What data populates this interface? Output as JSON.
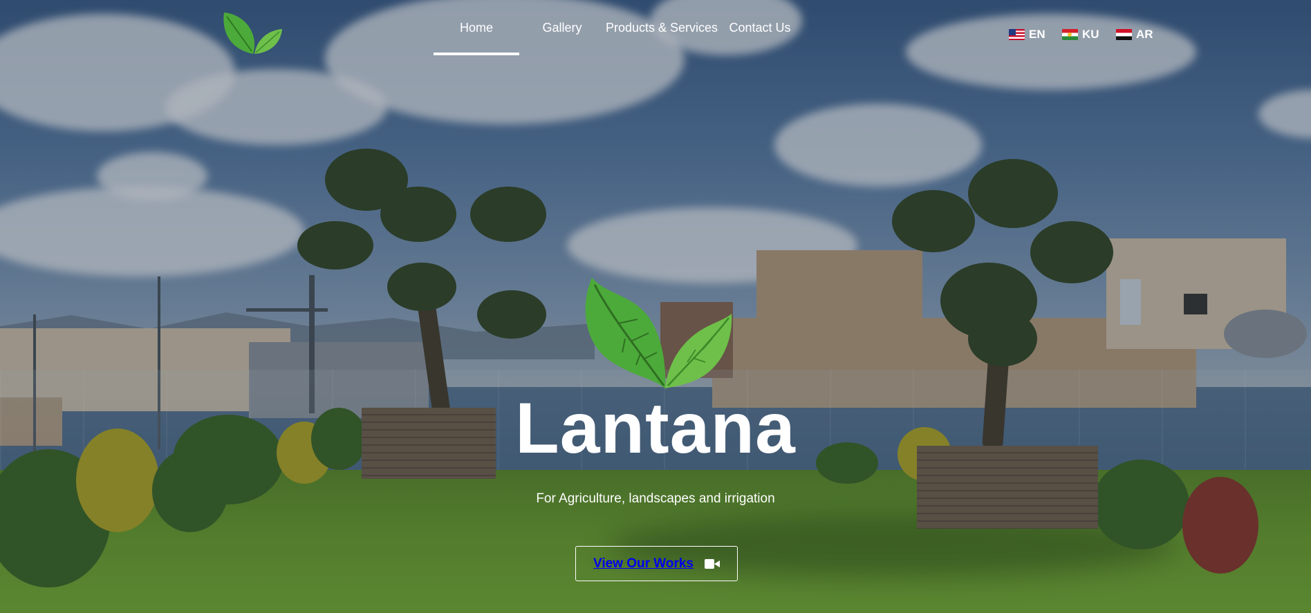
{
  "brand": {
    "logo_icon": "leaf-logo-icon"
  },
  "nav": {
    "items": [
      {
        "label": "Home",
        "active": true
      },
      {
        "label": "Gallery",
        "active": false
      },
      {
        "label": "Products & Services",
        "active": false
      },
      {
        "label": "Contact Us",
        "active": false
      }
    ]
  },
  "languages": [
    {
      "code": "EN",
      "flag_icon": "us-flag-icon"
    },
    {
      "code": "KU",
      "flag_icon": "kurdistan-flag-icon"
    },
    {
      "code": "AR",
      "flag_icon": "iraq-flag-icon"
    }
  ],
  "hero": {
    "title": "Lantana",
    "subtitle": "For Agriculture, landscapes and irrigation",
    "cta_label": "View Our Works",
    "cta_icon": "video-camera-icon",
    "leaf_icon": "leaf-icon"
  },
  "colors": {
    "leaf_green": "#4caa3a",
    "leaf_light": "#7ccb4f",
    "text": "#ffffff"
  }
}
